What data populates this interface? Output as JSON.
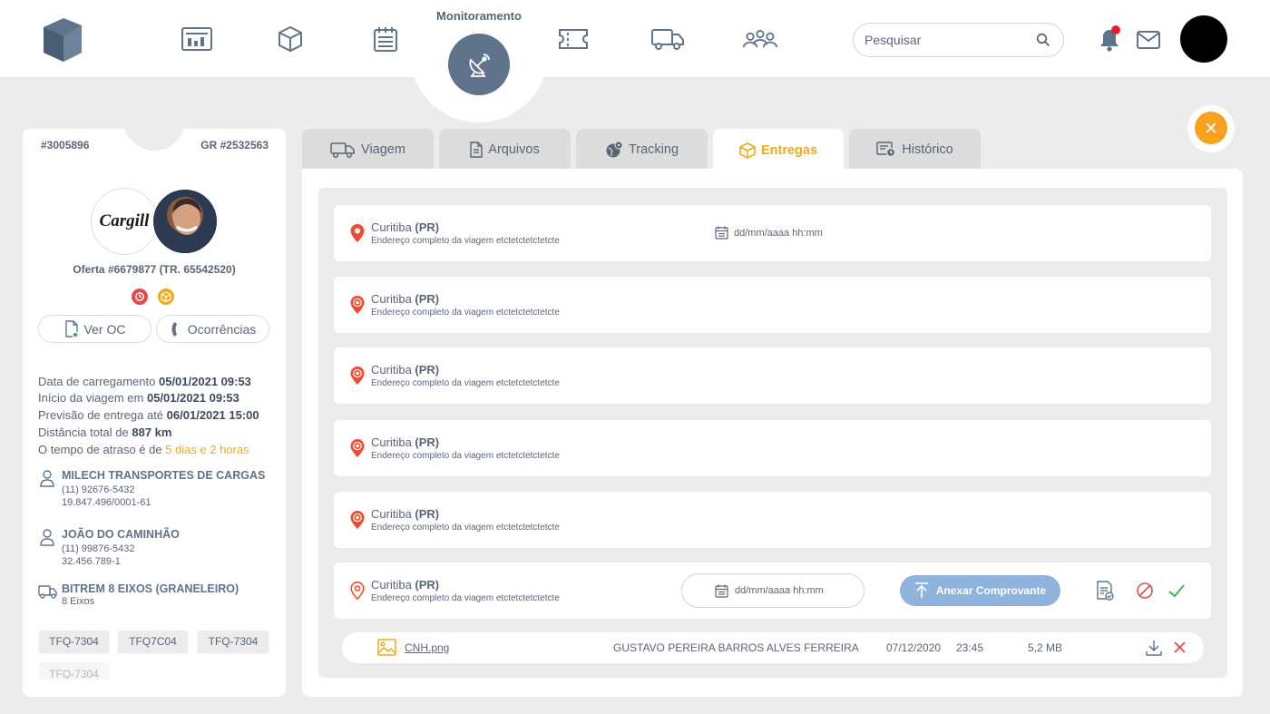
{
  "nav": {
    "active_label": "Monitoramento",
    "items": [
      "dashboard-icon",
      "box-icon",
      "calendar-list-icon",
      "satellite-icon",
      "ticket-icon",
      "truck-icon",
      "users-icon"
    ]
  },
  "search": {
    "placeholder": "Pesquisar"
  },
  "colors": {
    "accent": "#f0a81c",
    "primary": "#5f738a",
    "alert": "#e5202a",
    "attach": "#8fb3dc",
    "success": "#3fb34f"
  },
  "trip": {
    "id": "#3005896",
    "gr": "GR #2532563",
    "brand": "Cargill",
    "offer": "Oferta #6679877 (TR. 65542520)",
    "buttons": {
      "oc": "Ver OC",
      "occurrences": "Ocorrências"
    },
    "info": [
      {
        "label": "Data de carregamento",
        "value": "05/01/2021 09:53"
      },
      {
        "label": "Início da viagem em",
        "value": "05/01/2021 09:53"
      },
      {
        "label": "Previsão de entrega até",
        "value": "06/01/2021 15:00"
      },
      {
        "label": "Distância total de",
        "value": "887 km"
      }
    ],
    "delay": {
      "label": "O tempo de atraso é de",
      "value": "5 dias e 2 horas"
    },
    "carrier": {
      "name": "MILECH TRANSPORTES DE CARGAS",
      "phone": "(11) 92676-5432",
      "doc": "19.847.496/0001-61"
    },
    "driver": {
      "name": "JOÃO DO CAMINHÃO",
      "phone": "(11) 99876-5432",
      "doc": "32.456.789-1"
    },
    "vehicle": {
      "name": "BITREM 8 EIXOS (GRANELEIRO)",
      "axles": "8 Eixos"
    },
    "plates": [
      "TFQ-7304",
      "TFQ7C04",
      "TFQ-7304",
      "TFQ-7304"
    ]
  },
  "tabs": [
    {
      "label": "Viagem"
    },
    {
      "label": "Arquivos"
    },
    {
      "label": "Tracking"
    },
    {
      "label": "Entregas"
    },
    {
      "label": "Histórico"
    }
  ],
  "deliveries": [
    {
      "city": "Curitiba",
      "state": "(PR)",
      "address": "Endereço completo da viagem etctetctetctetcte",
      "date": "dd/mm/aaaa hh:mm"
    },
    {
      "city": "Curitiba",
      "state": "(PR)",
      "address": "Endereço completo da viagem etctetctetctetcte"
    },
    {
      "city": "Curitiba",
      "state": "(PR)",
      "address": "Endereço completo da viagem etctetctetctetcte"
    },
    {
      "city": "Curitiba",
      "state": "(PR)",
      "address": "Endereço completo da viagem etctetctetctetcte"
    },
    {
      "city": "Curitiba",
      "state": "(PR)",
      "address": "Endereço completo da viagem etctetctetctetcte"
    },
    {
      "city": "Curitiba",
      "state": "(PR)",
      "address": "Endereço completo da viagem etctetctetctetcte",
      "date_placeholder": "dd/mm/aaaa hh:mm",
      "attach_label": "Anexar Comprovante"
    }
  ],
  "file": {
    "name": "CNH.png",
    "uploader": "GUSTAVO PEREIRA BARROS ALVES FERREIRA",
    "date": "07/12/2020",
    "time": "23:45",
    "size": "5,2 MB"
  }
}
